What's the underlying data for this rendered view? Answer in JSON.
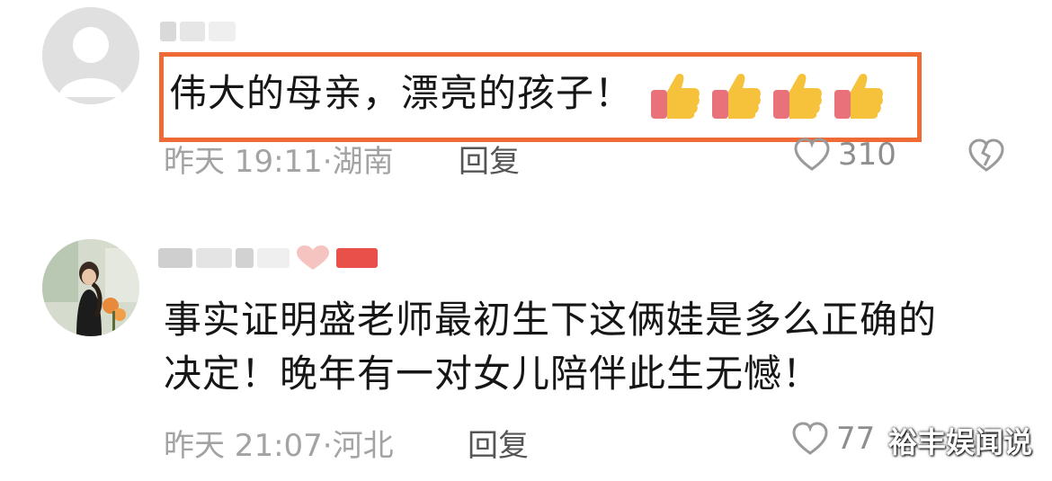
{
  "comments": [
    {
      "text": "伟大的母亲，漂亮的孩子！",
      "time": "昨天 19:11",
      "location": "湖南",
      "separator": "·",
      "reply_label": "回复",
      "likes": "310",
      "emoji": "thumbs-up-icon",
      "emoji_count": 4
    },
    {
      "text_line1": "事实证明盛老师最初生下这俩娃是多么正确的",
      "text_line2": "决定！晚年有一对女儿陪伴此生无憾！",
      "time": "昨天 21:07",
      "location": "河北",
      "separator": "·",
      "reply_label": "回复",
      "likes": "77"
    }
  ],
  "watermark": "裕丰娱闻说",
  "colors": {
    "highlight": "#f06a36",
    "meta_text": "#a3a3a3",
    "body_text": "#161616",
    "blur_red": "#e8504a"
  }
}
